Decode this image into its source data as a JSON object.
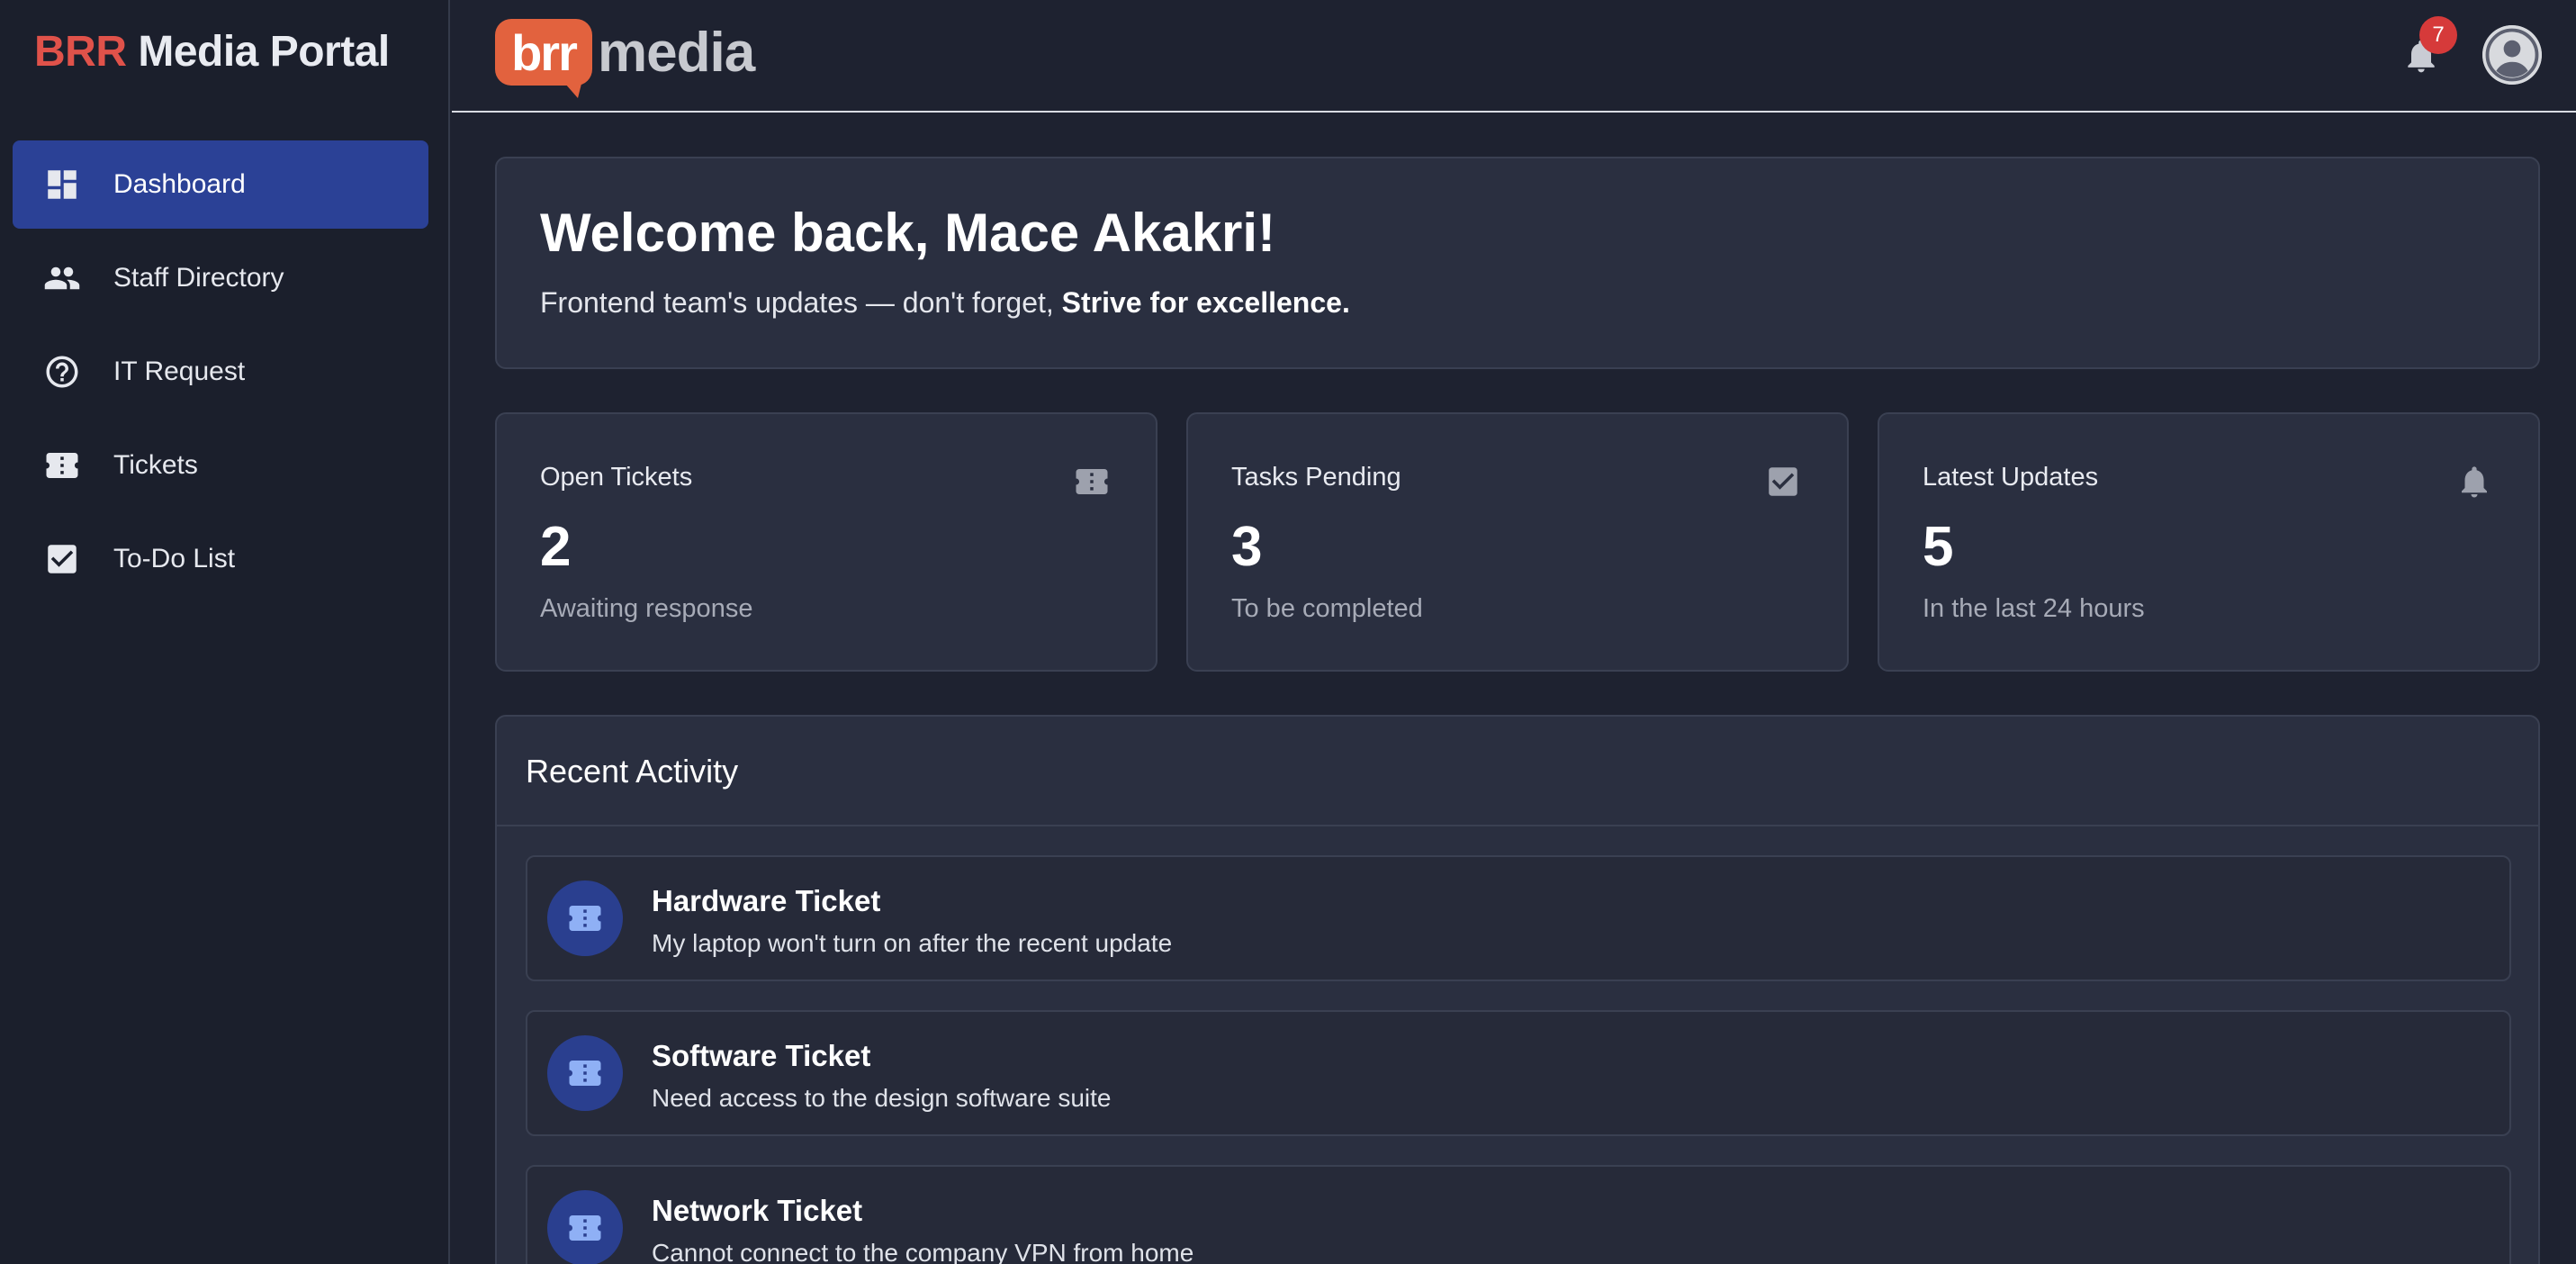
{
  "brand": {
    "accent": "BRR",
    "rest": "Media Portal"
  },
  "logo": {
    "badge": "brr",
    "word": "media"
  },
  "nav": [
    {
      "label": "Dashboard",
      "icon": "dashboard-icon",
      "active": true
    },
    {
      "label": "Staff Directory",
      "icon": "people-icon",
      "active": false
    },
    {
      "label": "IT Request",
      "icon": "help-circle-icon",
      "active": false
    },
    {
      "label": "Tickets",
      "icon": "ticket-icon",
      "active": false
    },
    {
      "label": "To-Do List",
      "icon": "checkbox-icon",
      "active": false
    }
  ],
  "header": {
    "notifications_count": "7"
  },
  "welcome": {
    "title": "Welcome back, Mace Akakri!",
    "message_prefix": "Frontend team's updates — don't forget, ",
    "message_emphasis": "Strive for excellence."
  },
  "stats": [
    {
      "label": "Open Tickets",
      "value": "2",
      "sub": "Awaiting response",
      "icon": "ticket-icon"
    },
    {
      "label": "Tasks Pending",
      "value": "3",
      "sub": "To be completed",
      "icon": "checkbox-icon"
    },
    {
      "label": "Latest Updates",
      "value": "5",
      "sub": "In the last 24 hours",
      "icon": "bell-icon"
    }
  ],
  "activity": {
    "title": "Recent Activity",
    "items": [
      {
        "title": "Hardware Ticket",
        "desc": "My laptop won't turn on after the recent update"
      },
      {
        "title": "Software Ticket",
        "desc": "Need access to the design software suite"
      },
      {
        "title": "Network Ticket",
        "desc": "Cannot connect to the company VPN from home"
      }
    ]
  },
  "colors": {
    "background": "#1e2230",
    "sidebar": "#1b1f2c",
    "card": "#2a2f40",
    "active_nav": "#2b4196",
    "brand_accent": "#e0524a",
    "notification_badge": "#d63a3a",
    "logo_orange": "#e2623e"
  }
}
